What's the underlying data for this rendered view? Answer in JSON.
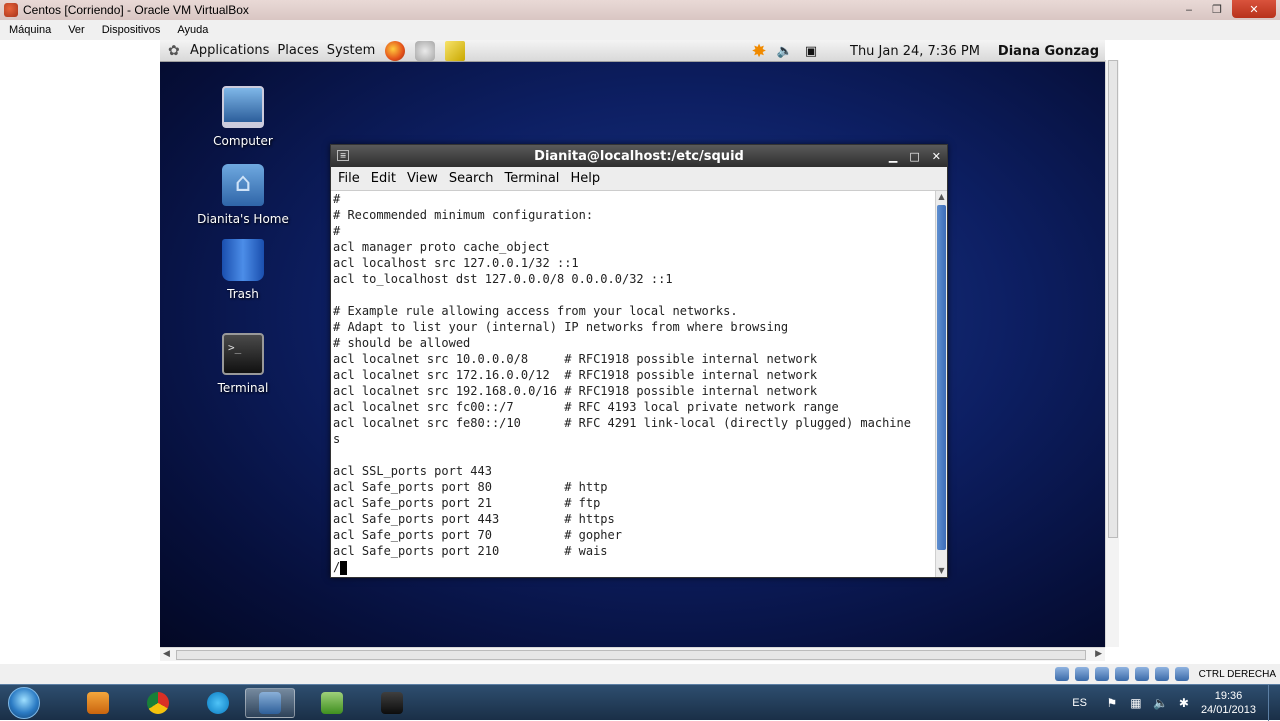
{
  "vbox": {
    "title": "Centos [Corriendo] - Oracle VM VirtualBox",
    "menu": [
      "Máquina",
      "Ver",
      "Dispositivos",
      "Ayuda"
    ],
    "minimize": "‒",
    "maximize": "❐",
    "close": "✕",
    "host_key": "CTRL DERECHA"
  },
  "gnome": {
    "menus": [
      "Applications",
      "Places",
      "System"
    ],
    "clock": "Thu Jan 24,  7:36 PM",
    "user": "Diana Gonzag"
  },
  "desktop": {
    "icons": [
      "Computer",
      "Dianita's Home",
      "Trash",
      "Terminal"
    ]
  },
  "terminal": {
    "title": "Dianita@localhost:/etc/squid",
    "menu": [
      "File",
      "Edit",
      "View",
      "Search",
      "Terminal",
      "Help"
    ],
    "lines": [
      "#",
      "# Recommended minimum configuration:",
      "#",
      "acl manager proto cache_object",
      "acl localhost src 127.0.0.1/32 ::1",
      "acl to_localhost dst 127.0.0.0/8 0.0.0.0/32 ::1",
      "",
      "# Example rule allowing access from your local networks.",
      "# Adapt to list your (internal) IP networks from where browsing",
      "# should be allowed",
      "acl localnet src 10.0.0.0/8     # RFC1918 possible internal network",
      "acl localnet src 172.16.0.0/12  # RFC1918 possible internal network",
      "acl localnet src 192.168.0.0/16 # RFC1918 possible internal network",
      "acl localnet src fc00::/7       # RFC 4193 local private network range",
      "acl localnet src fe80::/10      # RFC 4291 link-local (directly plugged) machine",
      "s",
      "",
      "acl SSL_ports port 443",
      "acl Safe_ports port 80          # http",
      "acl Safe_ports port 21          # ftp",
      "acl Safe_ports port 443         # https",
      "acl Safe_ports port 70          # gopher",
      "acl Safe_ports port 210         # wais"
    ],
    "prompt": "/"
  },
  "taskbar": {
    "lang": "ES",
    "time": "19:36",
    "date": "24/01/2013"
  }
}
